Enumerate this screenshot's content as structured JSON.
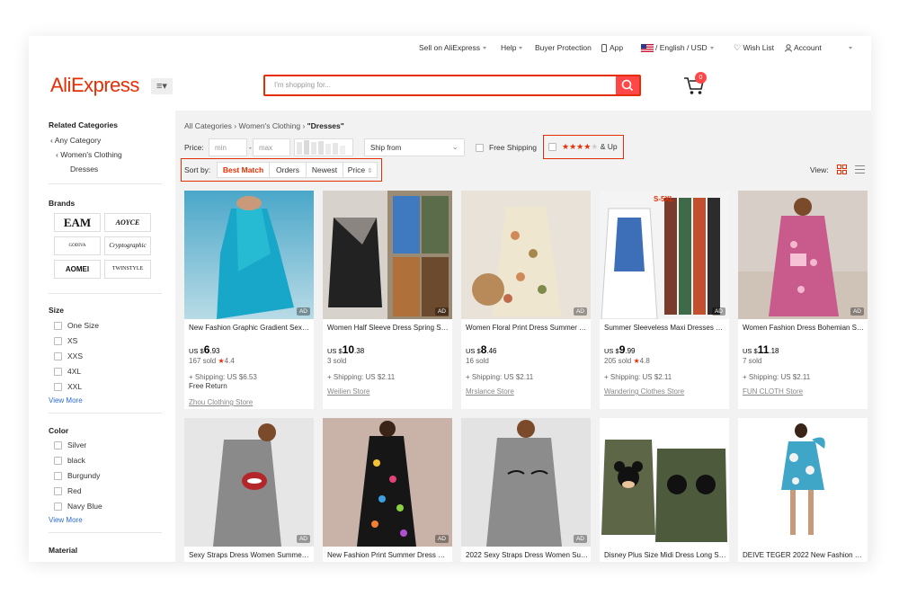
{
  "topbar": {
    "sell": "Sell on AliExpress",
    "help": "Help",
    "buyer_protection": "Buyer Protection",
    "app": "App",
    "locale": "/ English /  USD",
    "wishlist": "Wish List",
    "account": "Account"
  },
  "header": {
    "logo": "AliExpress",
    "search_placeholder": "I'm shopping for...",
    "cart_count": "0"
  },
  "sidebar": {
    "related_title": "Related Categories",
    "any_category": "Any Category",
    "womens_clothing": "Women's Clothing",
    "dresses": "Dresses",
    "brands_title": "Brands",
    "brands": [
      "EAM",
      "AOYCE",
      "GODIVA",
      "Cryptographic",
      "AOMEI",
      "TWINSTYLE"
    ],
    "size_title": "Size",
    "sizes": [
      "One Size",
      "XS",
      "XXS",
      "4XL",
      "XXL"
    ],
    "view_more": "View More",
    "color_title": "Color",
    "colors": [
      "Silver",
      "black",
      "Burgundy",
      "Red",
      "Navy Blue"
    ],
    "material_title": "Material"
  },
  "main": {
    "breadcrumb": {
      "all": "All Categories",
      "womens": "Women's Clothing",
      "current": "\"Dresses\""
    },
    "filters": {
      "price_label": "Price:",
      "min_placeholder": "min",
      "max_placeholder": "max",
      "dash": "-",
      "ship_from": "Ship from",
      "free_shipping": "Free Shipping",
      "stars": "★★★★",
      "and_up": "& Up"
    },
    "sort": {
      "label": "Sort by:",
      "options": [
        "Best Match",
        "Orders",
        "Newest",
        "Price"
      ],
      "active": "Best Match"
    },
    "view_label": "View:",
    "accent_color": "#e62e04"
  },
  "products": [
    {
      "title": "New Fashion Graphic Gradient Sexy Dress",
      "currency": "US $",
      "price_int": "6",
      "price_dec": ".93",
      "sold": "167 sold",
      "rating": "4.4",
      "shipping": "+ Shipping: US $6.53",
      "free_return": "Free Return",
      "store": "Zhou Clothing Store",
      "ad": "AD"
    },
    {
      "title": "Women Half Sleeve Dress Spring Summer",
      "currency": "US $",
      "price_int": "10",
      "price_dec": ".38",
      "sold": "3 sold",
      "rating": "",
      "shipping": "+ Shipping: US $2.11",
      "free_return": "",
      "store": "Weilien Store",
      "ad": "AD"
    },
    {
      "title": "Women Floral Print Dress Summer Casual",
      "currency": "US $",
      "price_int": "8",
      "price_dec": ".46",
      "sold": "16 sold",
      "rating": "",
      "shipping": "+ Shipping: US $2.11",
      "free_return": "",
      "store": "Mrslance Store",
      "ad": "AD"
    },
    {
      "title": "Summer Sleeveless Maxi Dresses Women",
      "currency": "US $",
      "price_int": "9",
      "price_dec": ".99",
      "sold": "205 sold",
      "rating": "4.8",
      "shipping": "+ Shipping: US $2.11",
      "free_return": "",
      "store": "Wandering Clothes Store",
      "ad": "AD"
    },
    {
      "title": "Women Fashion Dress Bohemian Style",
      "currency": "US $",
      "price_int": "11",
      "price_dec": ".18",
      "sold": "7 sold",
      "rating": "",
      "shipping": "+ Shipping: US $2.11",
      "free_return": "",
      "store": "FUN CLOTH Store",
      "ad": "AD"
    },
    {
      "title": "Sexy Straps Dress Women Summer Print",
      "ad": "AD"
    },
    {
      "title": "New Fashion Print Summer Dress Women",
      "ad": "AD"
    },
    {
      "title": "2022 Sexy Straps Dress Women Summer",
      "ad": "AD"
    },
    {
      "title": "Disney Plus Size Midi Dress Long Sleeve",
      "ad": ""
    },
    {
      "title": "DEIVE TEGER 2022 New Fashion Women",
      "ad": ""
    }
  ]
}
